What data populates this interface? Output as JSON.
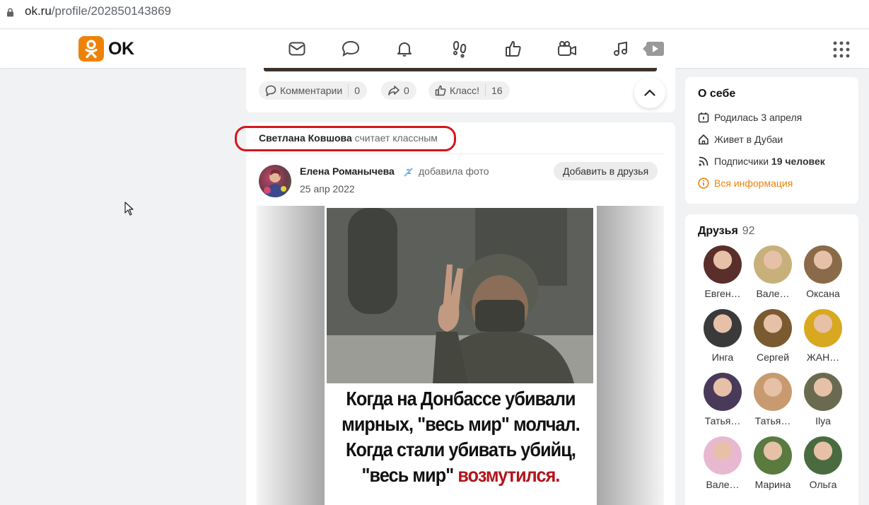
{
  "browser": {
    "url_host": "ok.ru",
    "url_path": "/profile/202850143869"
  },
  "header": {
    "logo_text": "OK",
    "nav_icons": [
      "mail-icon",
      "discussions-icon",
      "notifications-icon",
      "guests-icon",
      "likes-icon",
      "video-icon",
      "music-icon",
      "video-play-icon"
    ],
    "accent": "#ee8208"
  },
  "feed_top": {
    "comments_label": "Комментарии",
    "comments_count": "0",
    "shares_count": "0",
    "class_label": "Класс!",
    "class_count": "16"
  },
  "post": {
    "liked_by": "Светлана Ковшова",
    "liked_action": "считает классным",
    "author_name": "Елена Романычева",
    "author_action": "добавила фото",
    "date": "25 апр 2022",
    "add_friend_label": "Добавить в друзья",
    "caption_line1": "Когда на Донбассе убивали",
    "caption_line2": "мирных, \"весь мир\" молчал.",
    "caption_line3": "Когда стали убивать убийц,",
    "caption_line4_a": "\"весь мир\"",
    "caption_line4_b": "возмутился."
  },
  "about": {
    "title": "О себе",
    "born": "Родилась 3 апреля",
    "lives": "Живет в Дубаи",
    "subscribers_prefix": "Подписчики",
    "subscribers_value": "19 человек",
    "all_info": "Вся информация"
  },
  "friends": {
    "title": "Друзья",
    "count": "92",
    "items": [
      {
        "name": "Евген…",
        "color": "#5a2e2a"
      },
      {
        "name": "Вале…",
        "color": "#c8b07a"
      },
      {
        "name": "Оксана",
        "color": "#8a6a48"
      },
      {
        "name": "Инга",
        "color": "#3a3a3a"
      },
      {
        "name": "Сергей",
        "color": "#7a5a30"
      },
      {
        "name": "ЖАН…",
        "color": "#d8a820"
      },
      {
        "name": "Татья…",
        "color": "#4a3a5a"
      },
      {
        "name": "Татья…",
        "color": "#c89a70"
      },
      {
        "name": "Ilya",
        "color": "#6a6a50"
      },
      {
        "name": "Вале…",
        "color": "#e8b8d0"
      },
      {
        "name": "Марина",
        "color": "#5a7a40"
      },
      {
        "name": "Ольга",
        "color": "#4a6a40"
      }
    ]
  }
}
